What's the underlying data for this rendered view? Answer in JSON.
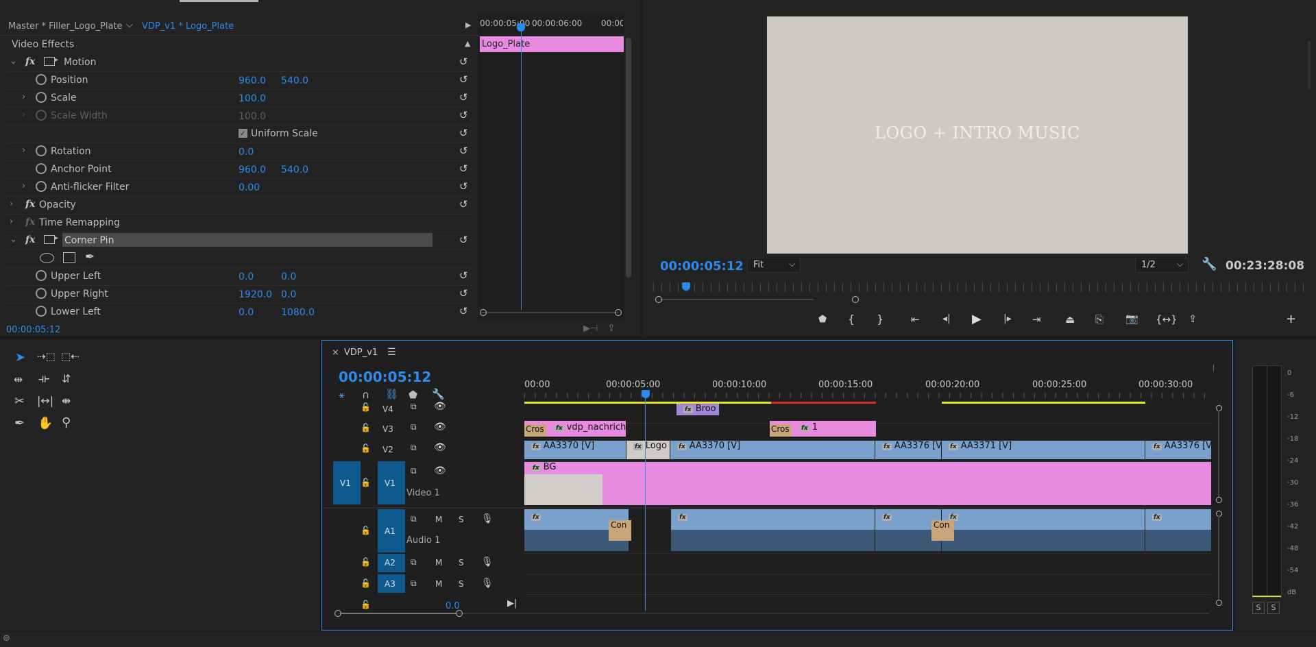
{
  "effect_controls": {
    "master_tab": "Master * Filler_Logo_Plate",
    "clip_tab": "VDP_v1 * Logo_Plate",
    "section": "Video Effects",
    "timecode": "00:00:05:12",
    "mini_ruler": [
      "00:00:05:00",
      "00:00:06:00",
      "00:00"
    ],
    "clip_label": "Logo_Plate",
    "motion": "Motion",
    "position": {
      "label": "Position",
      "x": "960.0",
      "y": "540.0"
    },
    "scale": {
      "label": "Scale",
      "value": "100.0"
    },
    "scale_width": {
      "label": "Scale Width",
      "value": "100.0"
    },
    "uniform_scale": "Uniform Scale",
    "rotation": {
      "label": "Rotation",
      "value": "0.0"
    },
    "anchor_point": {
      "label": "Anchor Point",
      "x": "960.0",
      "y": "540.0"
    },
    "anti_flicker": {
      "label": "Anti-flicker Filter",
      "value": "0.00"
    },
    "opacity": "Opacity",
    "time_remapping": "Time Remapping",
    "corner_pin": "Corner Pin",
    "upper_left": {
      "label": "Upper Left",
      "x": "0.0",
      "y": "0.0"
    },
    "upper_right": {
      "label": "Upper Right",
      "x": "1920.0",
      "y": "0.0"
    },
    "lower_left": {
      "label": "Lower Left",
      "x": "0.0",
      "y": "1080.0"
    }
  },
  "program_monitor": {
    "preview_text": "LOGO + INTRO MUSIC",
    "timecode": "00:00:05:12",
    "fit": "Fit",
    "resolution": "1/2",
    "duration": "00:23:28:08"
  },
  "timeline": {
    "tab": "VDP_v1",
    "timecode": "00:00:05:12",
    "ruler": [
      "00:00",
      "00:00:05:00",
      "00:00:10:00",
      "00:00:15:00",
      "00:00:20:00",
      "00:00:25:00",
      "00:00:30:00"
    ],
    "tracks": {
      "v4": "V4",
      "v3": "V3",
      "v2": "V2",
      "v1": "V1",
      "v1_src": "V1",
      "video1": "Video 1",
      "a1": "A1",
      "audio1": "Audio 1",
      "a2": "A2",
      "a3": "A3",
      "master_vol": "0.0",
      "m": "M",
      "s": "S"
    },
    "clips": {
      "v4_clip": "Broo",
      "v3_cross": "Cros",
      "v3_vdp": "vdp_nachrich",
      "v3_cross2": "Cros",
      "v3_one": "1",
      "v2_aa3370a": "AA3370 [V]",
      "v2_logo": "Logo",
      "v2_aa3370b": "AA3370 [V]",
      "v2_aa3376a": "AA3376 [V",
      "v2_aa3371": "AA3371 [V]",
      "v2_aa3376b": "AA3376 [V",
      "v1_bg": "BG",
      "a1_con1": "Con",
      "a1_con2": "Con"
    }
  },
  "meters": {
    "db": [
      "0",
      "-6",
      "-12",
      "-18",
      "-24",
      "-30",
      "-36",
      "-42",
      "-48",
      "-54",
      "dB"
    ],
    "solo": "S"
  }
}
